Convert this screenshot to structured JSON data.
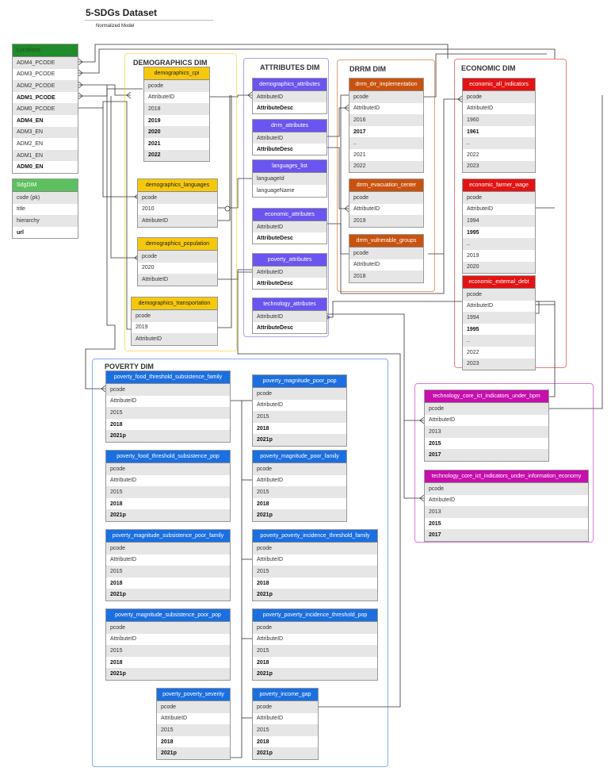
{
  "header": {
    "title": "5-SDGs Dataset",
    "subtitle": "Normalized Model"
  },
  "colors": {
    "locations": "#1f8b2a",
    "sdgdim": "#5dc05e",
    "demographics": "#f6c80b",
    "attributes": "#6a55f0",
    "drrm": "#c9530e",
    "economic": "#e41313",
    "poverty": "#1c6fe0",
    "technology": "#c60fab"
  },
  "groups": [
    {
      "id": "demographics",
      "label": "DEMOGRAPHICS DIM"
    },
    {
      "id": "attributes",
      "label": "ATTRIBUTES DIM"
    },
    {
      "id": "drrm",
      "label": "DRRM DIM"
    },
    {
      "id": "economic",
      "label": "ECONOMIC DIM"
    },
    {
      "id": "poverty",
      "label": "POVERTY DIM"
    },
    {
      "id": "technology",
      "label": ""
    }
  ],
  "entities": [
    {
      "id": "locations",
      "name": "Locations",
      "color": "locations",
      "fields": [
        "ADM4_PCODE",
        "ADM3_PCODE",
        "ADM2_PCODE",
        "ADM1_PCODE",
        "ADM0_PCODE",
        "ADM4_EN",
        "ADM3_EN",
        "ADM2_EN",
        "ADM1_EN",
        "ADM0_EN"
      ]
    },
    {
      "id": "sdgdim",
      "name": "SdgDIM",
      "color": "sdgdim",
      "fields": [
        "code (pk)",
        "title",
        "hierarchy",
        "url"
      ]
    },
    {
      "id": "demo_cpi",
      "name": "demographics_cpi",
      "color": "demographics",
      "fields": [
        "pcode",
        "AttributeID",
        "2018",
        "2019",
        "2020",
        "2021",
        "2022"
      ]
    },
    {
      "id": "demo_lang",
      "name": "demographics_languages",
      "color": "demographics",
      "fields": [
        "pcode",
        "2010",
        "AttributeID"
      ]
    },
    {
      "id": "demo_pop",
      "name": "demographics_population",
      "color": "demographics",
      "fields": [
        "pcode",
        "2020",
        "AttributeID"
      ]
    },
    {
      "id": "demo_trans",
      "name": "demographics_transportation",
      "color": "demographics",
      "fields": [
        "pcode",
        "2019",
        "AttributeID"
      ]
    },
    {
      "id": "attr_demo",
      "name": "demographics_attributes",
      "color": "attributes",
      "fields": [
        "AttributeID",
        "AttributeDesc"
      ]
    },
    {
      "id": "attr_drrm",
      "name": "drrm_attributes",
      "color": "attributes",
      "fields": [
        "AttributeID",
        "AttributeDesc"
      ]
    },
    {
      "id": "attr_lang",
      "name": "languages_list",
      "color": "attributes",
      "fields": [
        "languageId",
        "languageName"
      ]
    },
    {
      "id": "attr_econ",
      "name": "economic_attributes",
      "color": "attributes",
      "fields": [
        "AttributeID",
        "AttributeDesc"
      ]
    },
    {
      "id": "attr_pov",
      "name": "poverty_attributes",
      "color": "attributes",
      "fields": [
        "AttributeID",
        "AttributeDesc"
      ]
    },
    {
      "id": "attr_tech",
      "name": "technology_attributes",
      "color": "attributes",
      "fields": [
        "AttributeID",
        "AttributeDesc"
      ]
    },
    {
      "id": "drrm_impl",
      "name": "drrm_drr_implementation",
      "color": "drrm",
      "fields": [
        "pcode",
        "AttributeID",
        "2016",
        "2017",
        "..",
        "2021",
        "2022"
      ]
    },
    {
      "id": "drrm_evac",
      "name": "drrm_evacuation_center",
      "color": "drrm",
      "fields": [
        "pcode",
        "AttributeID",
        "2019"
      ]
    },
    {
      "id": "drrm_vuln",
      "name": "drrm_vulnerable_groups",
      "color": "drrm",
      "fields": [
        "pcode",
        "AttributeID",
        "2018"
      ]
    },
    {
      "id": "econ_all",
      "name": "economic_all_indicators",
      "color": "economic",
      "fields": [
        "pcode",
        "AttributeID",
        "1960",
        "1961",
        "..",
        "2022",
        "2023"
      ]
    },
    {
      "id": "econ_wage",
      "name": "economic_farmer_wage",
      "color": "economic",
      "fields": [
        "pcode",
        "AttributeID",
        "1994",
        "1995",
        "..",
        "2019",
        "2020"
      ]
    },
    {
      "id": "econ_debt",
      "name": "economic_external_debt",
      "color": "economic",
      "fields": [
        "pcode",
        "AttributeID",
        "1994",
        "1995",
        "..",
        "2022",
        "2023"
      ]
    },
    {
      "id": "pov_food_fam",
      "name": "poverty_food_threshold_subsistence_family",
      "color": "poverty",
      "fields": [
        "pcode",
        "AttributeID",
        "2015",
        "2018",
        "2021p"
      ]
    },
    {
      "id": "pov_mag_poor_pop",
      "name": "poverty_magnitude_poor_pop",
      "color": "poverty",
      "fields": [
        "pcode",
        "AttributeID",
        "2015",
        "2018",
        "2021p"
      ]
    },
    {
      "id": "pov_food_pop",
      "name": "poverty_food_threshold_subsistence_pop",
      "color": "poverty",
      "fields": [
        "pcode",
        "AttributeID",
        "2015",
        "2018",
        "2021p"
      ]
    },
    {
      "id": "pov_mag_poor_fam",
      "name": "poverty_magnitude_poor_family",
      "color": "poverty",
      "fields": [
        "pcode",
        "AttributeID",
        "2015",
        "2018",
        "2021p"
      ]
    },
    {
      "id": "pov_mag_sub_fam",
      "name": "poverty_magnitude_subsistence_poor_family",
      "color": "poverty",
      "fields": [
        "pcode",
        "AttributeID",
        "2015",
        "2018",
        "2021p"
      ]
    },
    {
      "id": "pov_inc_fam",
      "name": "poverty_poverty_incidence_threshold_family",
      "color": "poverty",
      "fields": [
        "pcode",
        "AttributeID",
        "2015",
        "2018",
        "2021p"
      ]
    },
    {
      "id": "pov_mag_sub_pop",
      "name": "poverty_magnitude_subsistence_poor_pop",
      "color": "poverty",
      "fields": [
        "pcode",
        "AttributeID",
        "2015",
        "2018",
        "2021p"
      ]
    },
    {
      "id": "pov_inc_pop",
      "name": "poverty_poverty_incidence_threshold_pop",
      "color": "poverty",
      "fields": [
        "pcode",
        "AttributeID",
        "2015",
        "2018",
        "2021p"
      ]
    },
    {
      "id": "pov_sev",
      "name": "poverty_poverty_severity",
      "color": "poverty",
      "fields": [
        "pcode",
        "AttributeID",
        "2015",
        "2018",
        "2021p"
      ]
    },
    {
      "id": "pov_gap",
      "name": "poverty_income_gap",
      "color": "poverty",
      "fields": [
        "pcode",
        "AttributeID",
        "2015",
        "2018",
        "2021p"
      ]
    },
    {
      "id": "tech_bpm",
      "name": "technology_core_ict_indicators_under_bpm",
      "color": "technology",
      "fields": [
        "pcode",
        "AttributeID",
        "2013",
        "2015",
        "2017"
      ]
    },
    {
      "id": "tech_info",
      "name": "technology_core_ict_indicators_under_information_economy",
      "color": "technology",
      "fields": [
        "pcode",
        "AttributeID",
        "2013",
        "2015",
        "2017"
      ]
    }
  ]
}
